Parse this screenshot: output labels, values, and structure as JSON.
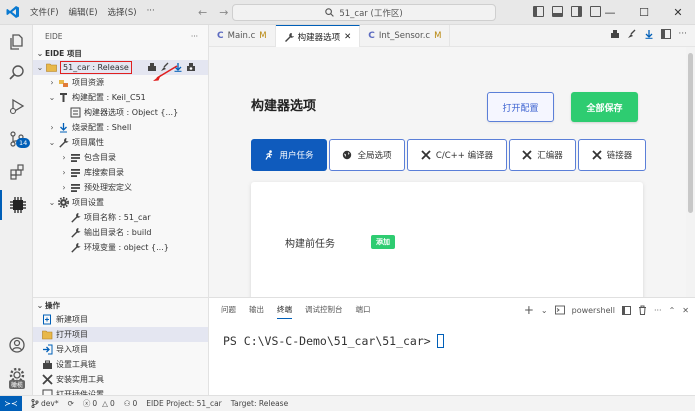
{
  "titlebar": {
    "menu": [
      "文件(F)",
      "编辑(E)",
      "选择(S)",
      "···"
    ],
    "search_text": "51_car (工作区)"
  },
  "activity": {
    "source_control_badge": "14",
    "mini_badge": "橄榄"
  },
  "sidebar": {
    "title": "EIDE",
    "more": "···",
    "section_title": "EIDE 项目",
    "project_label": "51_car : Release",
    "tree": [
      {
        "label": "项目资源",
        "indent": 1,
        "chev": "›",
        "icon": "resource-icon"
      },
      {
        "label": "构建配置 : Keil_C51",
        "indent": 1,
        "chev": "⌄",
        "icon": "build-config-icon"
      },
      {
        "label": "构建器选项 : Object {...}",
        "indent": 2,
        "chev": "",
        "icon": "builder-options-icon"
      },
      {
        "label": "烧录配置 : Shell",
        "indent": 1,
        "chev": "›",
        "icon": "flash-icon"
      },
      {
        "label": "项目属性",
        "indent": 1,
        "chev": "⌄",
        "icon": "properties-icon"
      },
      {
        "label": "包含目录",
        "indent": 2,
        "chev": "›",
        "icon": "list-icon"
      },
      {
        "label": "库搜索目录",
        "indent": 2,
        "chev": "›",
        "icon": "list-icon"
      },
      {
        "label": "预处理宏定义",
        "indent": 2,
        "chev": "›",
        "icon": "list-icon"
      },
      {
        "label": "项目设置",
        "indent": 1,
        "chev": "⌄",
        "icon": "gear-icon"
      },
      {
        "label": "项目名称 : 51_car",
        "indent": 2,
        "chev": "",
        "icon": "wrench-icon"
      },
      {
        "label": "输出目录名 : build",
        "indent": 2,
        "chev": "",
        "icon": "wrench-icon"
      },
      {
        "label": "环境变量 : object {...}",
        "indent": 2,
        "chev": "",
        "icon": "wrench-icon"
      }
    ],
    "ops_title": "操作",
    "ops": [
      {
        "label": "新建项目",
        "icon": "new-project-icon"
      },
      {
        "label": "打开项目",
        "icon": "open-project-icon"
      },
      {
        "label": "导入项目",
        "icon": "import-project-icon"
      },
      {
        "label": "设置工具链",
        "icon": "toolchain-icon"
      },
      {
        "label": "安装实用工具",
        "icon": "install-tools-icon"
      },
      {
        "label": "打开插件设置",
        "icon": "plugin-settings-icon"
      }
    ]
  },
  "tabs": [
    {
      "label": "Main.c",
      "mod": "M",
      "active": false
    },
    {
      "label": "构建器选项",
      "mod": "",
      "active": true
    },
    {
      "label": "Int_Sensor.c",
      "mod": "M",
      "active": false
    }
  ],
  "builder": {
    "title": "构建器选项",
    "open_config": "打开配置",
    "save_all": "全部保存",
    "tabs": [
      "用户任务",
      "全局选项",
      "C/C++ 编译器",
      "汇编器",
      "链接器"
    ],
    "pre_build_label": "构建前任务",
    "add_label": "添加"
  },
  "panel": {
    "tabs": [
      "问题",
      "输出",
      "终端",
      "调试控制台",
      "端口"
    ],
    "active_tab": "终端",
    "shell": "powershell",
    "prompt": "PS C:\\VS-C-Demo\\51_car\\51_car>"
  },
  "status": {
    "branch": "dev*",
    "errors": "0",
    "warnings": "0",
    "ports": "0",
    "eide_project": "EIDE Project: 51_car",
    "target": "Target: Release"
  },
  "colors": {
    "accent": "#005fb8",
    "green": "#2ecc71",
    "active_tab": "#0f5bbd",
    "highlight": "#e02020"
  }
}
